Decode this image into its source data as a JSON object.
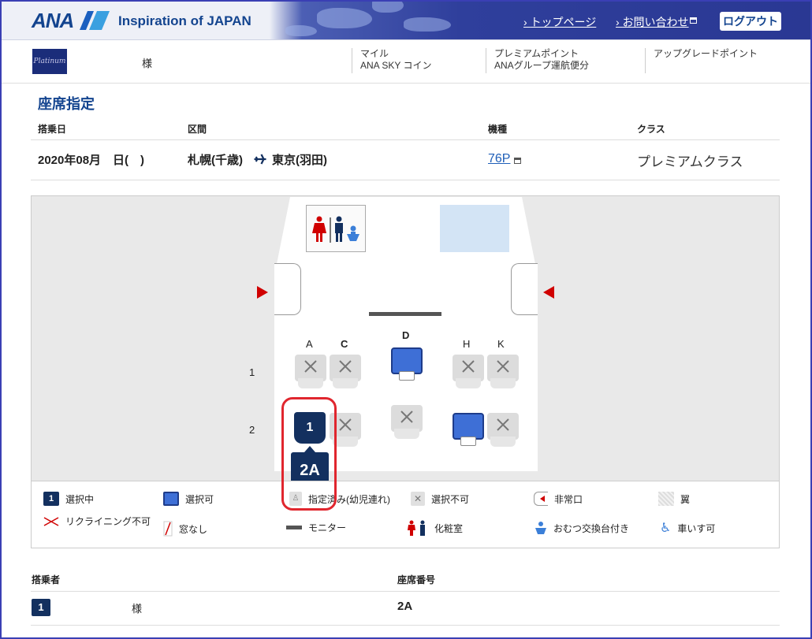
{
  "header": {
    "brand": "ANA",
    "tagline": "Inspiration of JAPAN",
    "top_link": "トップページ",
    "contact_link": "お問い合わせ",
    "logout": "ログアウト"
  },
  "member": {
    "badge": "Platinum",
    "name_suffix": "様",
    "miles_label": "マイル",
    "coin_label": "ANA SKY コイン",
    "premium_label": "プレミアムポイント",
    "group_label": "ANAグループ運航便分",
    "upgrade_label": "アップグレードポイント"
  },
  "page": {
    "title": "座席指定"
  },
  "flight": {
    "headers": {
      "date": "搭乗日",
      "route": "区間",
      "aircraft": "機種",
      "class": "クラス"
    },
    "date": "2020年08月　日(　)",
    "origin": "札幌(千歳)",
    "destination": "東京(羽田)",
    "aircraft": "76P",
    "cabin_class": "プレミアムクラス"
  },
  "seatmap": {
    "columns": [
      "A",
      "C",
      "D",
      "H",
      "K"
    ],
    "rows": [
      "1",
      "2"
    ],
    "selected_marker": "1",
    "selected_seat": "2A",
    "colors": {
      "selected": "#13305f",
      "available": "#3e6fd6",
      "exit": "#d00000",
      "ring": "#e0262e"
    }
  },
  "legend": {
    "selected": "選択中",
    "available": "選択可",
    "reserved_infant": "指定済み(幼児連れ)",
    "unavailable": "選択不可",
    "emergency_exit": "非常口",
    "wing": "翼",
    "no_recline": "リクライニング不可",
    "no_window": "窓なし",
    "monitor": "モニター",
    "lavatory": "化粧室",
    "diaper": "おむつ交換台付き",
    "wheelchair": "車いす可",
    "selected_marker": "1"
  },
  "passengers": {
    "headers": {
      "name": "搭乗者",
      "seat": "座席番号"
    },
    "rows": [
      {
        "number": "1",
        "name_suffix": "様",
        "seat": "2A"
      }
    ]
  }
}
